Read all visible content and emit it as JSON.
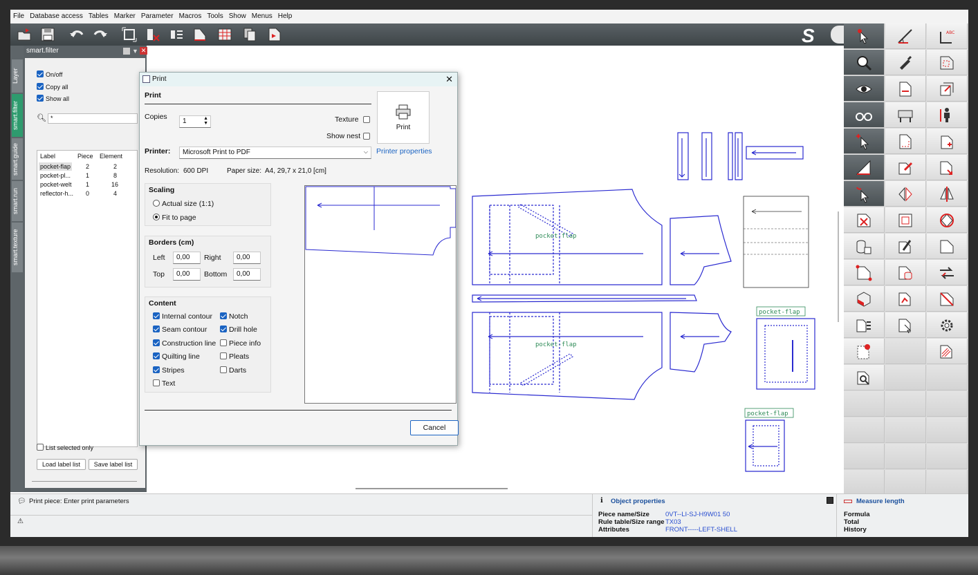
{
  "menu": [
    "File",
    "Database access",
    "Tables",
    "Marker",
    "Parameter",
    "Macros",
    "Tools",
    "Show",
    "Menus",
    "Help"
  ],
  "vertical_tabs": [
    "Layer",
    "smart.filter",
    "smart.guide",
    "smart.run",
    "smart.texture"
  ],
  "smart_filter": {
    "title": "smart.filter",
    "checks": [
      {
        "label": "On/off",
        "checked": true
      },
      {
        "label": "Copy all",
        "checked": true
      },
      {
        "label": "Show all",
        "checked": true
      }
    ],
    "search_value": "*",
    "columns": [
      "Label",
      "Piece",
      "Element"
    ],
    "rows": [
      {
        "label": "pocket-flap",
        "piece": "2",
        "element": "2"
      },
      {
        "label": "pocket-pl...",
        "piece": "1",
        "element": "8"
      },
      {
        "label": "pocket-welt",
        "piece": "1",
        "element": "16"
      },
      {
        "label": "reflector-h...",
        "piece": "0",
        "element": "4"
      }
    ],
    "list_selected_only": "List selected only",
    "load_button": "Load label list",
    "save_button": "Save label list"
  },
  "print_dialog": {
    "title": "Print",
    "section_print": "Print",
    "copies_label": "Copies",
    "copies_value": "1",
    "texture_label": "Texture",
    "show_nest_label": "Show nest",
    "print_button": "Print",
    "printer_label": "Printer:",
    "printer_value": "Microsoft Print to PDF",
    "printer_properties": "Printer properties",
    "resolution_label": "Resolution:",
    "resolution_value": "600 DPI",
    "paper_size_label": "Paper size:",
    "paper_size_value": "A4, 29,7 x 21,0 [cm]",
    "scaling": {
      "title": "Scaling",
      "actual_size": "Actual size (1:1)",
      "fit_to_page": "Fit to page",
      "selected": "fit_to_page"
    },
    "borders": {
      "title": "Borders (cm)",
      "left_label": "Left",
      "left": "0,00",
      "right_label": "Right",
      "right": "0,00",
      "top_label": "Top",
      "top": "0,00",
      "bottom_label": "Bottom",
      "bottom": "0,00"
    },
    "content": {
      "title": "Content",
      "items": [
        {
          "label": "Internal contour",
          "checked": true
        },
        {
          "label": "Notch",
          "checked": true
        },
        {
          "label": "Seam contour",
          "checked": true
        },
        {
          "label": "Drill hole",
          "checked": true
        },
        {
          "label": "Construction line",
          "checked": true
        },
        {
          "label": "Piece info",
          "checked": false
        },
        {
          "label": "Quilting line",
          "checked": true
        },
        {
          "label": "Pleats",
          "checked": false
        },
        {
          "label": "Stripes",
          "checked": true
        },
        {
          "label": "Darts",
          "checked": false
        },
        {
          "label": "Text",
          "checked": false
        }
      ]
    },
    "cancel_button": "Cancel"
  },
  "canvas_labels": {
    "pocket_flap_a": "pocket-flap",
    "pocket_flap_b": "pocket-flap",
    "pocket_flap_c": "pocket-flap",
    "pocket_flap_d": "pocket-flap"
  },
  "status": {
    "prompt": "Print piece: Enter print parameters",
    "object_properties_title": "Object properties",
    "piece_name_label": "Piece name/Size",
    "piece_name_value": "0VT--LI-SJ-H9W01 50",
    "rule_table_label": "Rule table/Size range",
    "rule_table_value": "TX03",
    "attributes_label": "Attributes",
    "attributes_value": "FRONT-----LEFT-SHELL",
    "measure_title": "Measure length",
    "formula_label": "Formula",
    "total_label": "Total",
    "history_label": "History"
  },
  "colors": {
    "pattern_line": "#2a2ad0",
    "label_green": "#2e8b57",
    "accent_blue": "#1a63c2",
    "active_tab": "#2e9b6e"
  }
}
